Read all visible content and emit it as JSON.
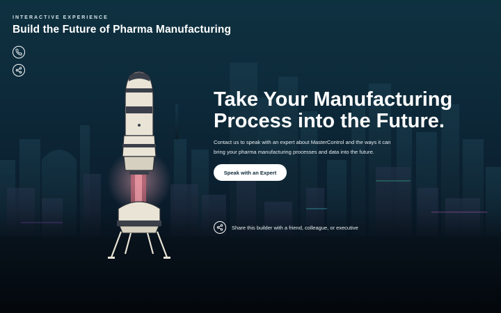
{
  "header": {
    "eyebrow": "INTERACTIVE EXPERIENCE",
    "title": "Build the Future of Pharma Manufacturing"
  },
  "side_icons": [
    {
      "icon": "phone-icon"
    },
    {
      "icon": "share-icon"
    }
  ],
  "hero": {
    "headline_line1": "Take Your Manufacturing",
    "headline_line2": "Process into the Future.",
    "body": "Contact us to speak with an expert about MasterControl and the ways it can bring your pharma manufacturing processes and data into the future.",
    "cta_label": "Speak with an Expert"
  },
  "share": {
    "label": "Share this builder with a friend, colleague, or executive",
    "icon": "share-icon"
  },
  "colors": {
    "background_top": "#0e3140",
    "background_bottom": "#050b12",
    "cta_bg": "#ffffff",
    "cta_text": "#0d2736",
    "rocket_flame": "#e86a7a"
  }
}
